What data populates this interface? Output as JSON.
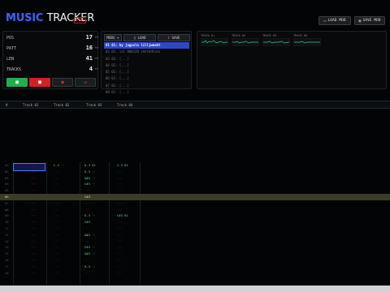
{
  "header": {
    "logo_a": "MUSIC",
    "logo_b": "TRACKER",
    "beta": "beta",
    "load_label": "LOAD MOD",
    "save_label": "SAVE MOD"
  },
  "status": {
    "rows": [
      {
        "label": "POS",
        "value": "17"
      },
      {
        "label": "PATT",
        "value": "16"
      },
      {
        "label": "LEN",
        "value": "41"
      },
      {
        "label": "TRACKS",
        "value": "4"
      }
    ]
  },
  "transport": {
    "play_icon": "play-icon",
    "stop_icon": "stop-icon",
    "record_icon": "record-icon",
    "loop_icon": "loop-icon"
  },
  "song": {
    "tools": [
      "MODS ▾",
      "♫ LOAD",
      "♪ SAVE"
    ],
    "items": [
      "01 01: by jugoslo lilljwmakt",
      "02 01: lol 000120 ventedless",
      "03 01: [...]",
      "04 01: [...]",
      "05 01: [...]",
      "06 01: [...]",
      "07 01: [...]",
      "08 01: [...]"
    ]
  },
  "scopes": [
    "TRACK 01",
    "TRACK 02",
    "TRACK 03",
    "TRACK 04"
  ],
  "pattern": {
    "headers": [
      "#",
      "Track 01",
      "Track 02",
      "Track 03",
      "Track 04"
    ],
    "rows": [
      {
        "n": "01",
        "c": [
          "···",
          "C-3 ··",
          "D-3 01",
          "C-3 01"
        ]
      },
      {
        "n": "02",
        "c": [
          "···",
          "···",
          "G-3 ··",
          "···"
        ]
      },
      {
        "n": "03",
        "c": [
          "···",
          "···",
          "A#3 ··",
          "···"
        ]
      },
      {
        "n": "04",
        "c": [
          "···",
          "···",
          "C#3 ··",
          "···"
        ]
      },
      {
        "n": "05",
        "c": [
          "···",
          "···",
          "···",
          "···"
        ]
      },
      {
        "n": "06",
        "c": [
          "···",
          "···",
          "C#3",
          "···"
        ]
      },
      {
        "n": "07",
        "c": [
          "···",
          "···",
          "···",
          "···"
        ]
      },
      {
        "n": "08",
        "c": [
          "···",
          "···",
          "···",
          "···"
        ]
      },
      {
        "n": "09",
        "c": [
          "···",
          "···",
          "D-3 ··",
          "C#3 01"
        ]
      },
      {
        "n": "10",
        "c": [
          "···",
          "···",
          "C#3",
          "···"
        ]
      },
      {
        "n": "11",
        "c": [
          "···",
          "···",
          "···",
          "···"
        ]
      },
      {
        "n": "12",
        "c": [
          "···",
          "···",
          "A#3 ··",
          "···"
        ]
      },
      {
        "n": "13",
        "c": [
          "···",
          "···",
          "···",
          "···"
        ]
      },
      {
        "n": "14",
        "c": [
          "···",
          "···",
          "F#3 ··",
          "···"
        ]
      },
      {
        "n": "15",
        "c": [
          "···",
          "···",
          "G#3 ··",
          "···"
        ]
      },
      {
        "n": "16",
        "c": [
          "···",
          "···",
          "···",
          "···"
        ]
      },
      {
        "n": "17",
        "c": [
          "···",
          "···",
          "D-3 ··",
          "···"
        ]
      },
      {
        "n": "18",
        "c": [
          "···",
          "···",
          "···",
          "···"
        ]
      }
    ]
  },
  "colors": {
    "accent": "#3f63ff",
    "play": "#1fb04c",
    "stop": "#d32020",
    "record": "#b01818",
    "highlight_row": "#3d3b26"
  }
}
